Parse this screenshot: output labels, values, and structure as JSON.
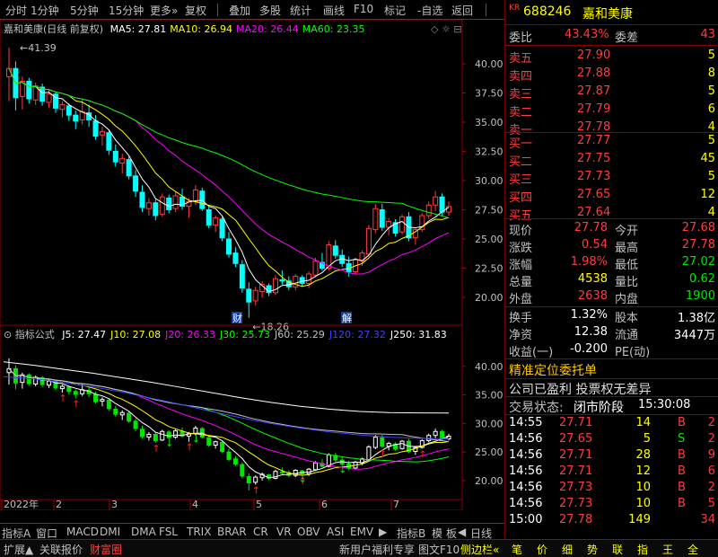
{
  "toolbar": {
    "items": [
      "分时",
      "1分钟",
      "5分钟",
      "15分钟",
      "更多»",
      "复权",
      "叠加",
      "多股",
      "统计",
      "画线",
      "F10",
      "标记",
      "-自选",
      "返回"
    ]
  },
  "chart_data": {
    "type": "line",
    "title": "嘉和美康(日线 前复权)",
    "price_axis": [
      40.0,
      37.5,
      35.0,
      32.5,
      30.0,
      27.5,
      25.0,
      22.5,
      20.0
    ],
    "price_range": [
      18.0,
      43.0
    ],
    "candles": [
      [
        38.9,
        41.39,
        36.8,
        39.6
      ],
      [
        39.6,
        40.2,
        36.0,
        37.1
      ],
      [
        37.2,
        38.9,
        36.1,
        38.5
      ],
      [
        38.5,
        38.8,
        36.6,
        37.0
      ],
      [
        36.9,
        38.4,
        36.5,
        38.1
      ],
      [
        38.0,
        38.3,
        36.4,
        36.8
      ],
      [
        36.7,
        37.8,
        36.2,
        37.4
      ],
      [
        37.4,
        37.6,
        35.8,
        36.2
      ],
      [
        36.1,
        36.8,
        35.4,
        36.5
      ],
      [
        36.4,
        36.6,
        35.1,
        35.6
      ],
      [
        35.6,
        36.0,
        34.4,
        35.1
      ],
      [
        35.2,
        37.0,
        34.8,
        35.9
      ],
      [
        35.8,
        36.5,
        34.6,
        35.2
      ],
      [
        35.1,
        35.6,
        33.5,
        33.8
      ],
      [
        33.9,
        34.6,
        33.0,
        34.2
      ],
      [
        34.1,
        34.3,
        32.2,
        32.6
      ],
      [
        32.5,
        33.1,
        31.2,
        31.6
      ],
      [
        31.5,
        32.3,
        30.6,
        31.9
      ],
      [
        31.8,
        32.1,
        30.1,
        30.4
      ],
      [
        30.4,
        30.9,
        28.6,
        29.1
      ],
      [
        29.0,
        29.6,
        27.3,
        27.7
      ],
      [
        27.6,
        28.5,
        27.0,
        28.1
      ],
      [
        28.1,
        28.4,
        26.6,
        27.0
      ],
      [
        27.1,
        28.9,
        26.9,
        28.6
      ],
      [
        28.5,
        28.8,
        27.2,
        27.5
      ],
      [
        27.6,
        29.0,
        27.3,
        28.7
      ],
      [
        28.6,
        29.3,
        27.5,
        27.8
      ],
      [
        27.8,
        28.5,
        26.8,
        28.2
      ],
      [
        28.2,
        29.6,
        27.9,
        29.2
      ],
      [
        29.1,
        29.4,
        27.4,
        27.6
      ],
      [
        27.5,
        27.9,
        25.9,
        26.2
      ],
      [
        26.2,
        27.0,
        25.6,
        26.8
      ],
      [
        26.7,
        26.9,
        24.8,
        25.1
      ],
      [
        25.0,
        25.6,
        23.4,
        23.7
      ],
      [
        23.8,
        24.3,
        22.6,
        22.9
      ],
      [
        22.8,
        23.2,
        20.4,
        20.8
      ],
      [
        20.7,
        21.3,
        18.26,
        19.6
      ],
      [
        19.7,
        20.9,
        19.3,
        20.6
      ],
      [
        20.5,
        21.4,
        20.0,
        21.1
      ],
      [
        21.0,
        21.2,
        20.1,
        20.4
      ],
      [
        20.4,
        21.9,
        20.2,
        21.6
      ],
      [
        21.5,
        22.3,
        21.1,
        21.4
      ],
      [
        21.4,
        21.8,
        20.6,
        20.9
      ],
      [
        20.9,
        22.0,
        20.6,
        21.8
      ],
      [
        21.7,
        21.9,
        20.9,
        21.2
      ],
      [
        21.2,
        22.2,
        20.8,
        22.0
      ],
      [
        21.9,
        23.4,
        21.7,
        23.1
      ],
      [
        23.0,
        23.8,
        22.3,
        22.5
      ],
      [
        22.5,
        24.8,
        22.3,
        24.5
      ],
      [
        24.4,
        24.9,
        23.3,
        23.6
      ],
      [
        23.6,
        24.1,
        22.6,
        22.9
      ],
      [
        22.9,
        23.5,
        21.8,
        22.2
      ],
      [
        22.2,
        23.4,
        22.0,
        23.2
      ],
      [
        23.1,
        24.0,
        22.7,
        23.8
      ],
      [
        23.7,
        26.2,
        23.5,
        25.9
      ],
      [
        25.8,
        28.0,
        25.5,
        27.6
      ],
      [
        27.5,
        28.0,
        25.7,
        26.0
      ],
      [
        26.0,
        26.8,
        25.3,
        26.5
      ],
      [
        26.4,
        26.7,
        25.2,
        25.5
      ],
      [
        25.6,
        27.1,
        25.4,
        26.9
      ],
      [
        26.9,
        27.3,
        24.8,
        25.1
      ],
      [
        25.1,
        26.0,
        24.5,
        25.8
      ],
      [
        25.8,
        27.2,
        25.6,
        27.0
      ],
      [
        27.0,
        28.2,
        26.7,
        27.9
      ],
      [
        27.9,
        29.1,
        27.4,
        28.6
      ],
      [
        28.6,
        28.9,
        27.0,
        27.3
      ],
      [
        27.3,
        28.2,
        27.0,
        27.78
      ]
    ],
    "ma_label_price": {
      "MA5": "27.81",
      "MA10": "26.94",
      "MA20": "26.44",
      "MA60": "23.35"
    },
    "ma_colors": {
      "MA5": "#ffffff",
      "MA10": "#ffff00",
      "MA20": "#ff00ff",
      "MA60": "#00ff00"
    },
    "high_label": "41.39",
    "low_label": "18.26",
    "markers": [
      "财",
      "解"
    ],
    "indicator": {
      "title": "指标公式",
      "labels": [
        {
          "name": "J5",
          "value": "27.47",
          "color": "#ffffff"
        },
        {
          "name": "J10",
          "value": "27.08",
          "color": "#ffff00"
        },
        {
          "name": "J20",
          "value": "26.33",
          "color": "#ff00ff"
        },
        {
          "name": "J30",
          "value": "25.73",
          "color": "#00ff00"
        },
        {
          "name": "J60",
          "value": "25.29",
          "color": "#c0c0c0"
        },
        {
          "name": "J120",
          "value": "27.32",
          "color": "#4040ff"
        },
        {
          "name": "J250",
          "value": "31.83",
          "color": "#ffffff"
        }
      ],
      "axis": [
        40.0,
        35.0,
        30.0,
        25.0,
        20.0
      ]
    },
    "x_labels": [
      "2022年",
      "2",
      "3",
      "4",
      "5",
      "6",
      "7"
    ]
  },
  "indicator_tabs": [
    "指标A",
    "窗口",
    "MACD",
    "DMI",
    "DMA",
    "FSL",
    "TRIX",
    "BRAR",
    "CR",
    "VR",
    "OBV",
    "ASI",
    "EMV",
    "▶",
    "指标B",
    "模",
    "板",
    "◀",
    "日线"
  ],
  "status_tabs": [
    "扩展▲",
    "关联报价",
    "财富圈"
  ],
  "status_right": [
    "新用户福利专享",
    "图文F10",
    "侧边栏«"
  ],
  "status_icons": [
    "笔",
    "价",
    "细",
    "势",
    "联",
    "指",
    "王",
    "全"
  ],
  "quote": {
    "market": "KR",
    "code": "688246",
    "name": "嘉和美康",
    "weibi_label": "委比",
    "weibi": "43.43%",
    "weicha_label": "委差",
    "weicha": "43",
    "sell": [
      {
        "label": "卖五",
        "price": "27.90",
        "vol": "5"
      },
      {
        "label": "卖四",
        "price": "27.88",
        "vol": "8"
      },
      {
        "label": "卖三",
        "price": "27.87",
        "vol": "5"
      },
      {
        "label": "卖二",
        "price": "27.79",
        "vol": "6"
      },
      {
        "label": "卖一",
        "price": "27.78",
        "vol": "4"
      }
    ],
    "buy": [
      {
        "label": "买一",
        "price": "27.77",
        "vol": "5"
      },
      {
        "label": "买二",
        "price": "27.75",
        "vol": "45"
      },
      {
        "label": "买三",
        "price": "27.73",
        "vol": "5"
      },
      {
        "label": "买四",
        "price": "27.65",
        "vol": "12"
      },
      {
        "label": "买五",
        "price": "27.64",
        "vol": "4"
      }
    ],
    "stats": [
      {
        "l1": "现价",
        "v1": "27.78",
        "c1": "red",
        "l2": "今开",
        "v2": "27.68",
        "c2": "red"
      },
      {
        "l1": "涨跌",
        "v1": "0.54",
        "c1": "red",
        "l2": "最高",
        "v2": "27.78",
        "c2": "red"
      },
      {
        "l1": "涨幅",
        "v1": "1.98%",
        "c1": "red",
        "l2": "最低",
        "v2": "27.02",
        "c2": "green"
      },
      {
        "l1": "总量",
        "v1": "4538",
        "c1": "yellow",
        "l2": "量比",
        "v2": "0.62",
        "c2": "green"
      },
      {
        "l1": "外盘",
        "v1": "2638",
        "c1": "red",
        "l2": "内盘",
        "v2": "1900",
        "c2": "green"
      }
    ],
    "stats2": [
      {
        "l1": "换手",
        "v1": "1.32%",
        "l2": "股本",
        "v2": "1.38亿"
      },
      {
        "l1": "净资",
        "v1": "12.38",
        "l2": "流通",
        "v2": "3447万"
      },
      {
        "l1": "收益(一)",
        "v1": "-0.200",
        "l2": "PE(动)",
        "v2": ""
      }
    ],
    "notice1": "精准定位委托单",
    "notice2": "公司已盈利 投票权无差异",
    "trade_status_label": "交易状态:",
    "trade_status": "闭市阶段",
    "trade_time": "15:30:08",
    "ticks": [
      {
        "t": "14:55",
        "p": "27.71",
        "v": "14",
        "s": "B",
        "n": "2"
      },
      {
        "t": "14:56",
        "p": "27.65",
        "v": "5",
        "s": "S",
        "n": "2"
      },
      {
        "t": "14:56",
        "p": "27.71",
        "v": "28",
        "s": "B",
        "n": "9"
      },
      {
        "t": "14:56",
        "p": "27.71",
        "v": "12",
        "s": "B",
        "n": "6"
      },
      {
        "t": "14:56",
        "p": "27.73",
        "v": "10",
        "s": "B",
        "n": "2"
      },
      {
        "t": "14:56",
        "p": "27.73",
        "v": "10",
        "s": "B",
        "n": "5"
      },
      {
        "t": "15:00",
        "p": "27.78",
        "v": "149",
        "s": "",
        "n": "34"
      }
    ]
  }
}
